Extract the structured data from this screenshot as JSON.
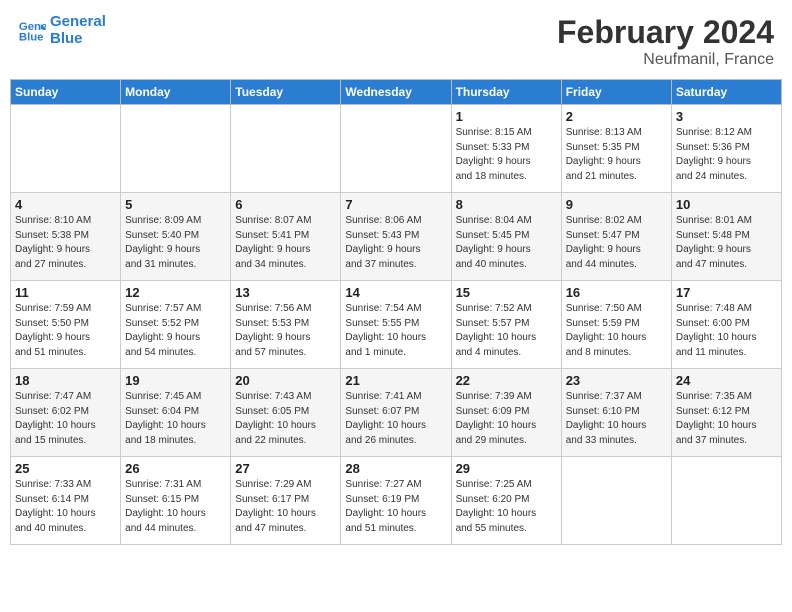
{
  "header": {
    "logo_line1": "General",
    "logo_line2": "Blue",
    "month": "February 2024",
    "location": "Neufmanil, France"
  },
  "weekdays": [
    "Sunday",
    "Monday",
    "Tuesday",
    "Wednesday",
    "Thursday",
    "Friday",
    "Saturday"
  ],
  "weeks": [
    [
      {
        "day": "",
        "info": ""
      },
      {
        "day": "",
        "info": ""
      },
      {
        "day": "",
        "info": ""
      },
      {
        "day": "",
        "info": ""
      },
      {
        "day": "1",
        "info": "Sunrise: 8:15 AM\nSunset: 5:33 PM\nDaylight: 9 hours\nand 18 minutes."
      },
      {
        "day": "2",
        "info": "Sunrise: 8:13 AM\nSunset: 5:35 PM\nDaylight: 9 hours\nand 21 minutes."
      },
      {
        "day": "3",
        "info": "Sunrise: 8:12 AM\nSunset: 5:36 PM\nDaylight: 9 hours\nand 24 minutes."
      }
    ],
    [
      {
        "day": "4",
        "info": "Sunrise: 8:10 AM\nSunset: 5:38 PM\nDaylight: 9 hours\nand 27 minutes."
      },
      {
        "day": "5",
        "info": "Sunrise: 8:09 AM\nSunset: 5:40 PM\nDaylight: 9 hours\nand 31 minutes."
      },
      {
        "day": "6",
        "info": "Sunrise: 8:07 AM\nSunset: 5:41 PM\nDaylight: 9 hours\nand 34 minutes."
      },
      {
        "day": "7",
        "info": "Sunrise: 8:06 AM\nSunset: 5:43 PM\nDaylight: 9 hours\nand 37 minutes."
      },
      {
        "day": "8",
        "info": "Sunrise: 8:04 AM\nSunset: 5:45 PM\nDaylight: 9 hours\nand 40 minutes."
      },
      {
        "day": "9",
        "info": "Sunrise: 8:02 AM\nSunset: 5:47 PM\nDaylight: 9 hours\nand 44 minutes."
      },
      {
        "day": "10",
        "info": "Sunrise: 8:01 AM\nSunset: 5:48 PM\nDaylight: 9 hours\nand 47 minutes."
      }
    ],
    [
      {
        "day": "11",
        "info": "Sunrise: 7:59 AM\nSunset: 5:50 PM\nDaylight: 9 hours\nand 51 minutes."
      },
      {
        "day": "12",
        "info": "Sunrise: 7:57 AM\nSunset: 5:52 PM\nDaylight: 9 hours\nand 54 minutes."
      },
      {
        "day": "13",
        "info": "Sunrise: 7:56 AM\nSunset: 5:53 PM\nDaylight: 9 hours\nand 57 minutes."
      },
      {
        "day": "14",
        "info": "Sunrise: 7:54 AM\nSunset: 5:55 PM\nDaylight: 10 hours\nand 1 minute."
      },
      {
        "day": "15",
        "info": "Sunrise: 7:52 AM\nSunset: 5:57 PM\nDaylight: 10 hours\nand 4 minutes."
      },
      {
        "day": "16",
        "info": "Sunrise: 7:50 AM\nSunset: 5:59 PM\nDaylight: 10 hours\nand 8 minutes."
      },
      {
        "day": "17",
        "info": "Sunrise: 7:48 AM\nSunset: 6:00 PM\nDaylight: 10 hours\nand 11 minutes."
      }
    ],
    [
      {
        "day": "18",
        "info": "Sunrise: 7:47 AM\nSunset: 6:02 PM\nDaylight: 10 hours\nand 15 minutes."
      },
      {
        "day": "19",
        "info": "Sunrise: 7:45 AM\nSunset: 6:04 PM\nDaylight: 10 hours\nand 18 minutes."
      },
      {
        "day": "20",
        "info": "Sunrise: 7:43 AM\nSunset: 6:05 PM\nDaylight: 10 hours\nand 22 minutes."
      },
      {
        "day": "21",
        "info": "Sunrise: 7:41 AM\nSunset: 6:07 PM\nDaylight: 10 hours\nand 26 minutes."
      },
      {
        "day": "22",
        "info": "Sunrise: 7:39 AM\nSunset: 6:09 PM\nDaylight: 10 hours\nand 29 minutes."
      },
      {
        "day": "23",
        "info": "Sunrise: 7:37 AM\nSunset: 6:10 PM\nDaylight: 10 hours\nand 33 minutes."
      },
      {
        "day": "24",
        "info": "Sunrise: 7:35 AM\nSunset: 6:12 PM\nDaylight: 10 hours\nand 37 minutes."
      }
    ],
    [
      {
        "day": "25",
        "info": "Sunrise: 7:33 AM\nSunset: 6:14 PM\nDaylight: 10 hours\nand 40 minutes."
      },
      {
        "day": "26",
        "info": "Sunrise: 7:31 AM\nSunset: 6:15 PM\nDaylight: 10 hours\nand 44 minutes."
      },
      {
        "day": "27",
        "info": "Sunrise: 7:29 AM\nSunset: 6:17 PM\nDaylight: 10 hours\nand 47 minutes."
      },
      {
        "day": "28",
        "info": "Sunrise: 7:27 AM\nSunset: 6:19 PM\nDaylight: 10 hours\nand 51 minutes."
      },
      {
        "day": "29",
        "info": "Sunrise: 7:25 AM\nSunset: 6:20 PM\nDaylight: 10 hours\nand 55 minutes."
      },
      {
        "day": "",
        "info": ""
      },
      {
        "day": "",
        "info": ""
      }
    ]
  ]
}
